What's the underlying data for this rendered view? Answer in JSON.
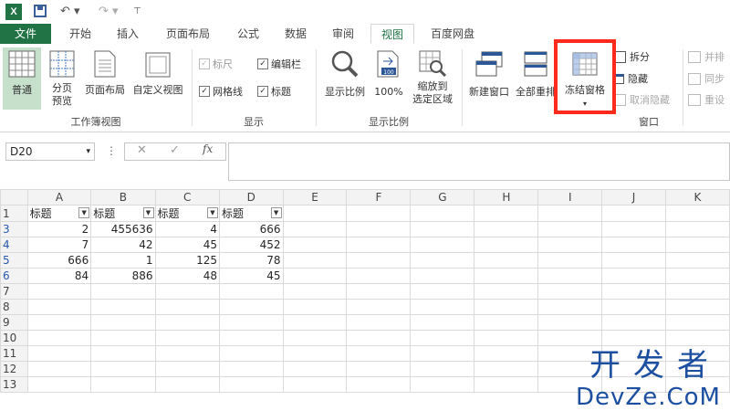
{
  "quick_access": {
    "logo": "X"
  },
  "tabs": [
    {
      "label": "文件"
    },
    {
      "label": "开始"
    },
    {
      "label": "插入"
    },
    {
      "label": "页面布局"
    },
    {
      "label": "公式"
    },
    {
      "label": "数据"
    },
    {
      "label": "审阅"
    },
    {
      "label": "视图"
    },
    {
      "label": "百度网盘"
    }
  ],
  "ribbon": {
    "workbook_views": {
      "label": "工作簿视图",
      "normal": "普通",
      "page_break_line1": "分页",
      "page_break_line2": "预览",
      "page_layout": "页面布局",
      "custom_view": "自定义视图"
    },
    "show": {
      "label": "显示",
      "ruler": "标尺",
      "formula_bar": "编辑栏",
      "gridlines": "网格线",
      "headings": "标题"
    },
    "zoom": {
      "label": "显示比例",
      "zoom": "显示比例",
      "hundred": "100%",
      "hundred_icon": "100",
      "zoom_sel_line1": "缩放到",
      "zoom_sel_line2": "选定区域"
    },
    "window": {
      "label": "窗口",
      "new_window": "新建窗口",
      "arrange_all": "全部重排",
      "freeze_panes": "冻结窗格",
      "split": "拆分",
      "hide": "隐藏",
      "unhide": "取消隐藏",
      "side_by_side": "并排",
      "sync_scroll": "同步",
      "reset": "重设"
    }
  },
  "formula_bar": {
    "name_box": "D20",
    "cancel": "✕",
    "enter": "✓",
    "fx": "fx",
    "value": ""
  },
  "sheet": {
    "columns": [
      "A",
      "B",
      "C",
      "D",
      "E",
      "F",
      "G",
      "H",
      "I",
      "J",
      "K"
    ],
    "header_row": {
      "row": "1",
      "cells": [
        "标题",
        "标题",
        "标题",
        "标题"
      ]
    },
    "rows": [
      {
        "row": "3",
        "cells": [
          "2",
          "455636",
          "4",
          "666"
        ]
      },
      {
        "row": "4",
        "cells": [
          "7",
          "42",
          "45",
          "452"
        ]
      },
      {
        "row": "5",
        "cells": [
          "666",
          "1",
          "125",
          "78"
        ]
      },
      {
        "row": "6",
        "cells": [
          "84",
          "886",
          "48",
          "45"
        ]
      },
      {
        "row": "7",
        "cells": [
          "",
          "",
          "",
          ""
        ]
      },
      {
        "row": "8",
        "cells": [
          "",
          "",
          "",
          ""
        ]
      },
      {
        "row": "9",
        "cells": [
          "",
          "",
          "",
          ""
        ]
      },
      {
        "row": "10",
        "cells": [
          "",
          "",
          "",
          ""
        ]
      },
      {
        "row": "11",
        "cells": [
          "",
          "",
          "",
          ""
        ]
      },
      {
        "row": "12",
        "cells": [
          "",
          "",
          "",
          ""
        ]
      },
      {
        "row": "13",
        "cells": [
          "",
          "",
          "",
          ""
        ]
      }
    ]
  },
  "watermark": {
    "line1": "开发者",
    "line2": "DevZe.CoM"
  },
  "colors": {
    "excel_green": "#217346",
    "highlight_red": "#ff2a1a",
    "filtered_row_blue": "#2a58b0"
  }
}
